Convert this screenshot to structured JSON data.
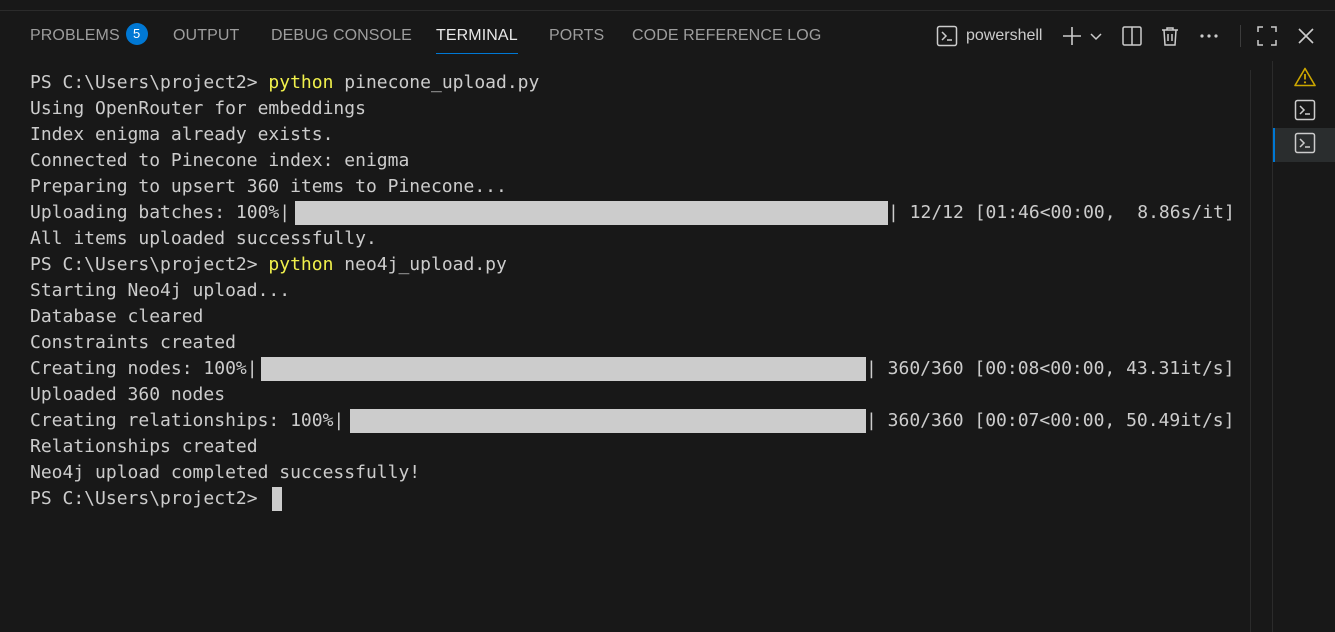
{
  "panel_tabs": [
    {
      "label": "PROBLEMS",
      "badge": "5",
      "active": false
    },
    {
      "label": "OUTPUT",
      "active": false
    },
    {
      "label": "DEBUG CONSOLE",
      "active": false
    },
    {
      "label": "TERMINAL",
      "active": true
    },
    {
      "label": "PORTS",
      "active": false
    },
    {
      "label": "CODE REFERENCE LOG",
      "active": false
    }
  ],
  "toolbar": {
    "shell_name": "powershell",
    "icons": [
      "terminal-icon",
      "plus-icon",
      "chevron-down-icon",
      "split-icon",
      "trash-icon",
      "ellipsis-icon",
      "maximize-icon",
      "close-icon"
    ]
  },
  "terminal": {
    "lines": [
      {
        "prompt": "PS C:\\Users\\project2> ",
        "cmd": "python",
        "args": " pinecone_upload.py"
      },
      {
        "text": "Using OpenRouter for embeddings"
      },
      {
        "text": "Index enigma already exists."
      },
      {
        "text": "Connected to Pinecone index: enigma"
      },
      {
        "text": "Preparing to upsert 360 items to Pinecone..."
      },
      {
        "prefix": "Uploading batches: 100%|",
        "progress": 1.0,
        "suffix": "| 12/12 [01:46<00:00,  8.86s/it]"
      },
      {
        "text": "All items uploaded successfully."
      },
      {
        "prompt": "PS C:\\Users\\project2> ",
        "cmd": "python",
        "args": " neo4j_upload.py"
      },
      {
        "text": "Starting Neo4j upload..."
      },
      {
        "text": "Database cleared"
      },
      {
        "text": "Constraints created"
      },
      {
        "prefix": "Creating nodes: 100%|",
        "progress": 1.0,
        "suffix": "| 360/360 [00:08<00:00, 43.31it/s]"
      },
      {
        "text": "Uploaded 360 nodes"
      },
      {
        "prefix": "Creating relationships: 100%|",
        "progress": 1.0,
        "suffix": "| 360/360 [00:07<00:00, 50.49it/s]"
      },
      {
        "text": "Relationships created"
      },
      {
        "text": "Neo4j upload completed successfully!"
      },
      {
        "prompt": "PS C:\\Users\\project2> ",
        "cursor": true
      }
    ]
  },
  "side_panel": {
    "items": [
      {
        "icon": "warning-icon",
        "active": false
      },
      {
        "icon": "terminal-icon",
        "active": false
      },
      {
        "icon": "terminal-icon",
        "active": true
      }
    ]
  },
  "colors": {
    "background": "#181818",
    "text": "#cccccc",
    "command": "#f1f14c",
    "accent": "#0078d4",
    "warning": "#cca700",
    "progress_fill": "#cccccc"
  }
}
